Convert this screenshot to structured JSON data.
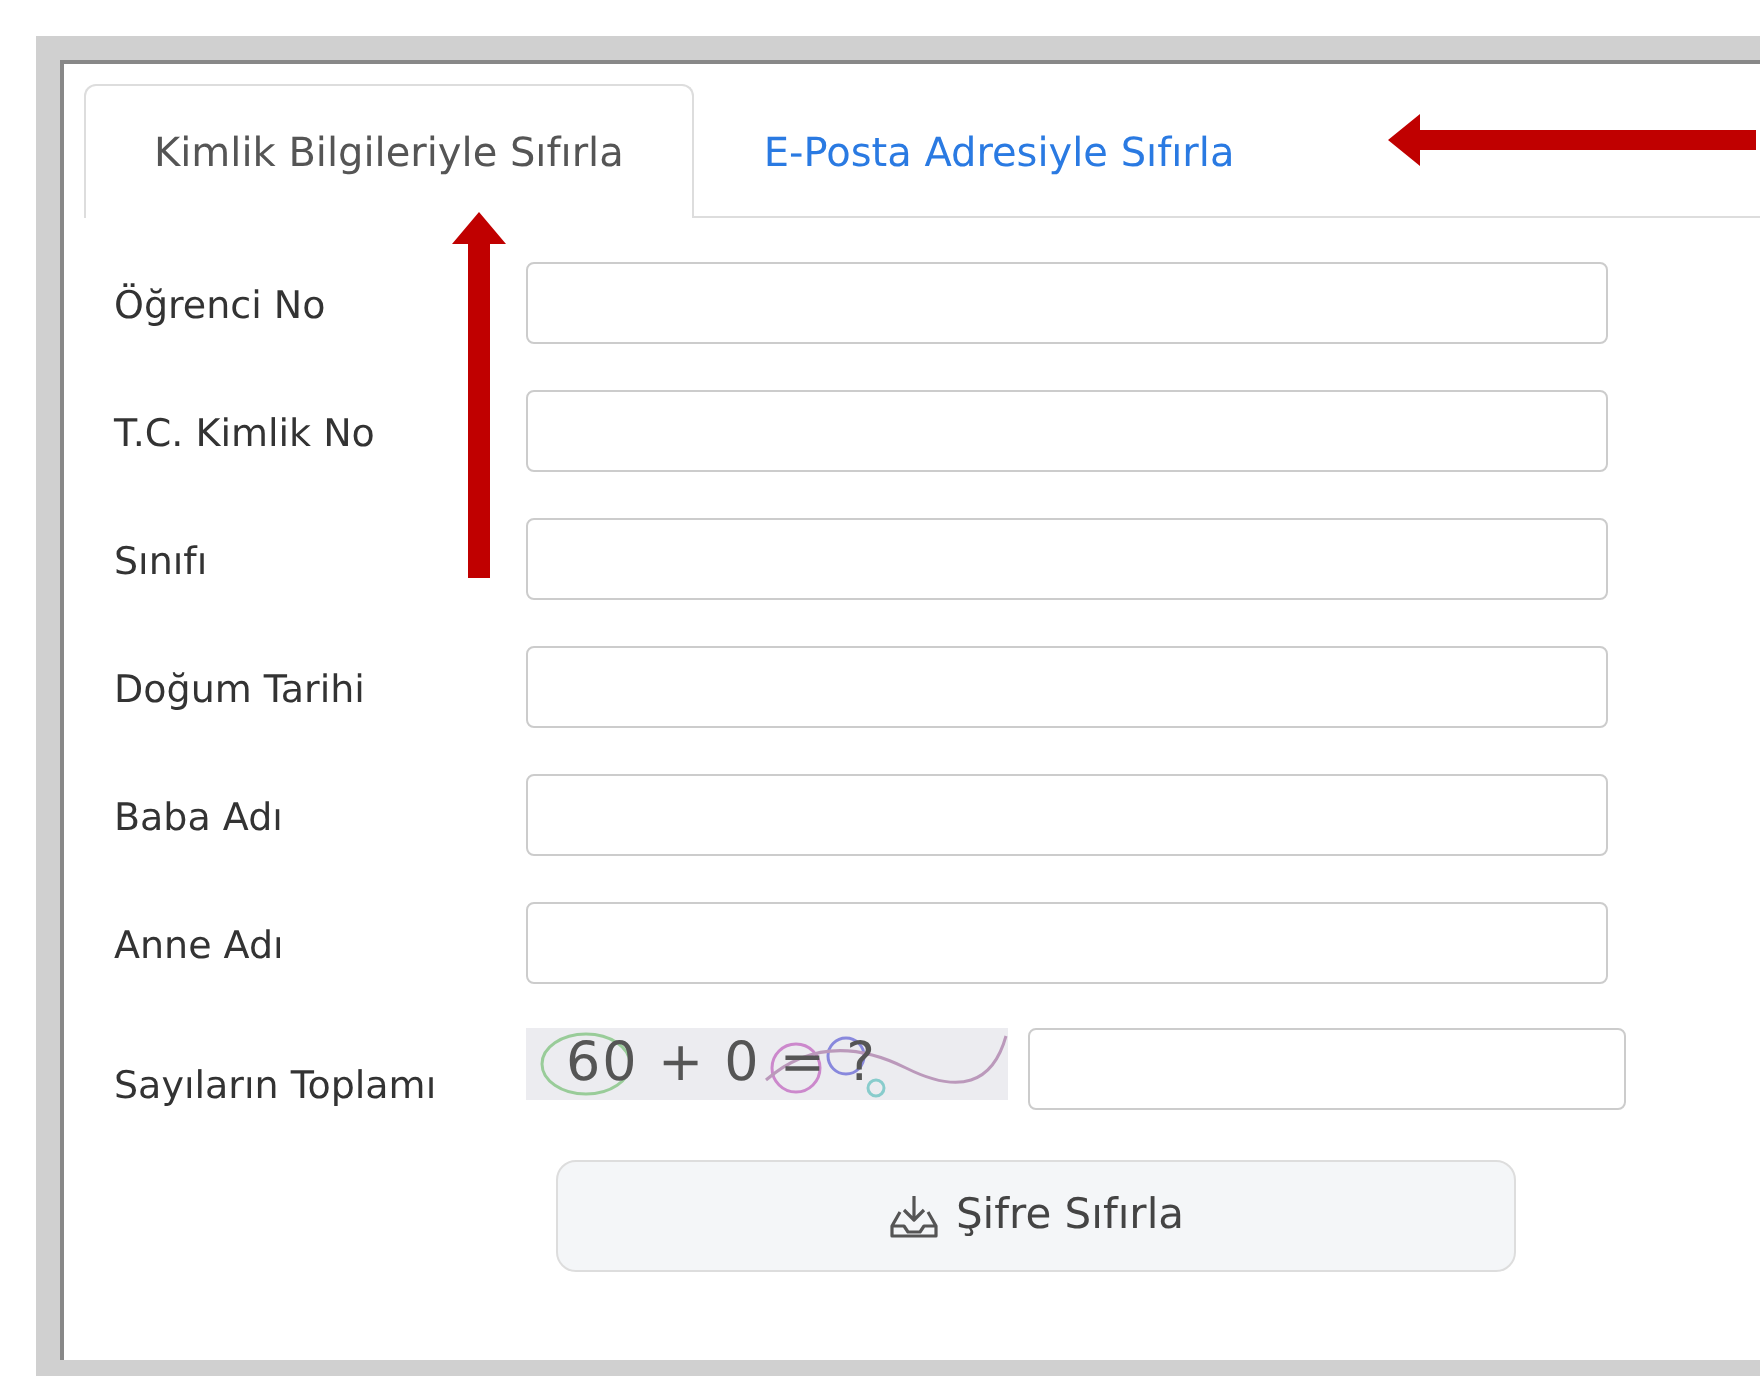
{
  "tabs": [
    {
      "label": "Kimlik Bilgileriyle Sıfırla",
      "selected": true
    },
    {
      "label": "E-Posta Adresiyle Sıfırla",
      "selected": false
    }
  ],
  "fields": [
    {
      "label": "Öğrenci No"
    },
    {
      "label": "T.C. Kimlik No"
    },
    {
      "label": "Sınıfı"
    },
    {
      "label": "Doğum Tarihi"
    },
    {
      "label": "Baba Adı"
    },
    {
      "label": "Anne Adı"
    }
  ],
  "captcha": {
    "label": "Sayıların Toplamı",
    "question": "60 + 0 = ?"
  },
  "submit_button": "Şifre Sıfırla"
}
